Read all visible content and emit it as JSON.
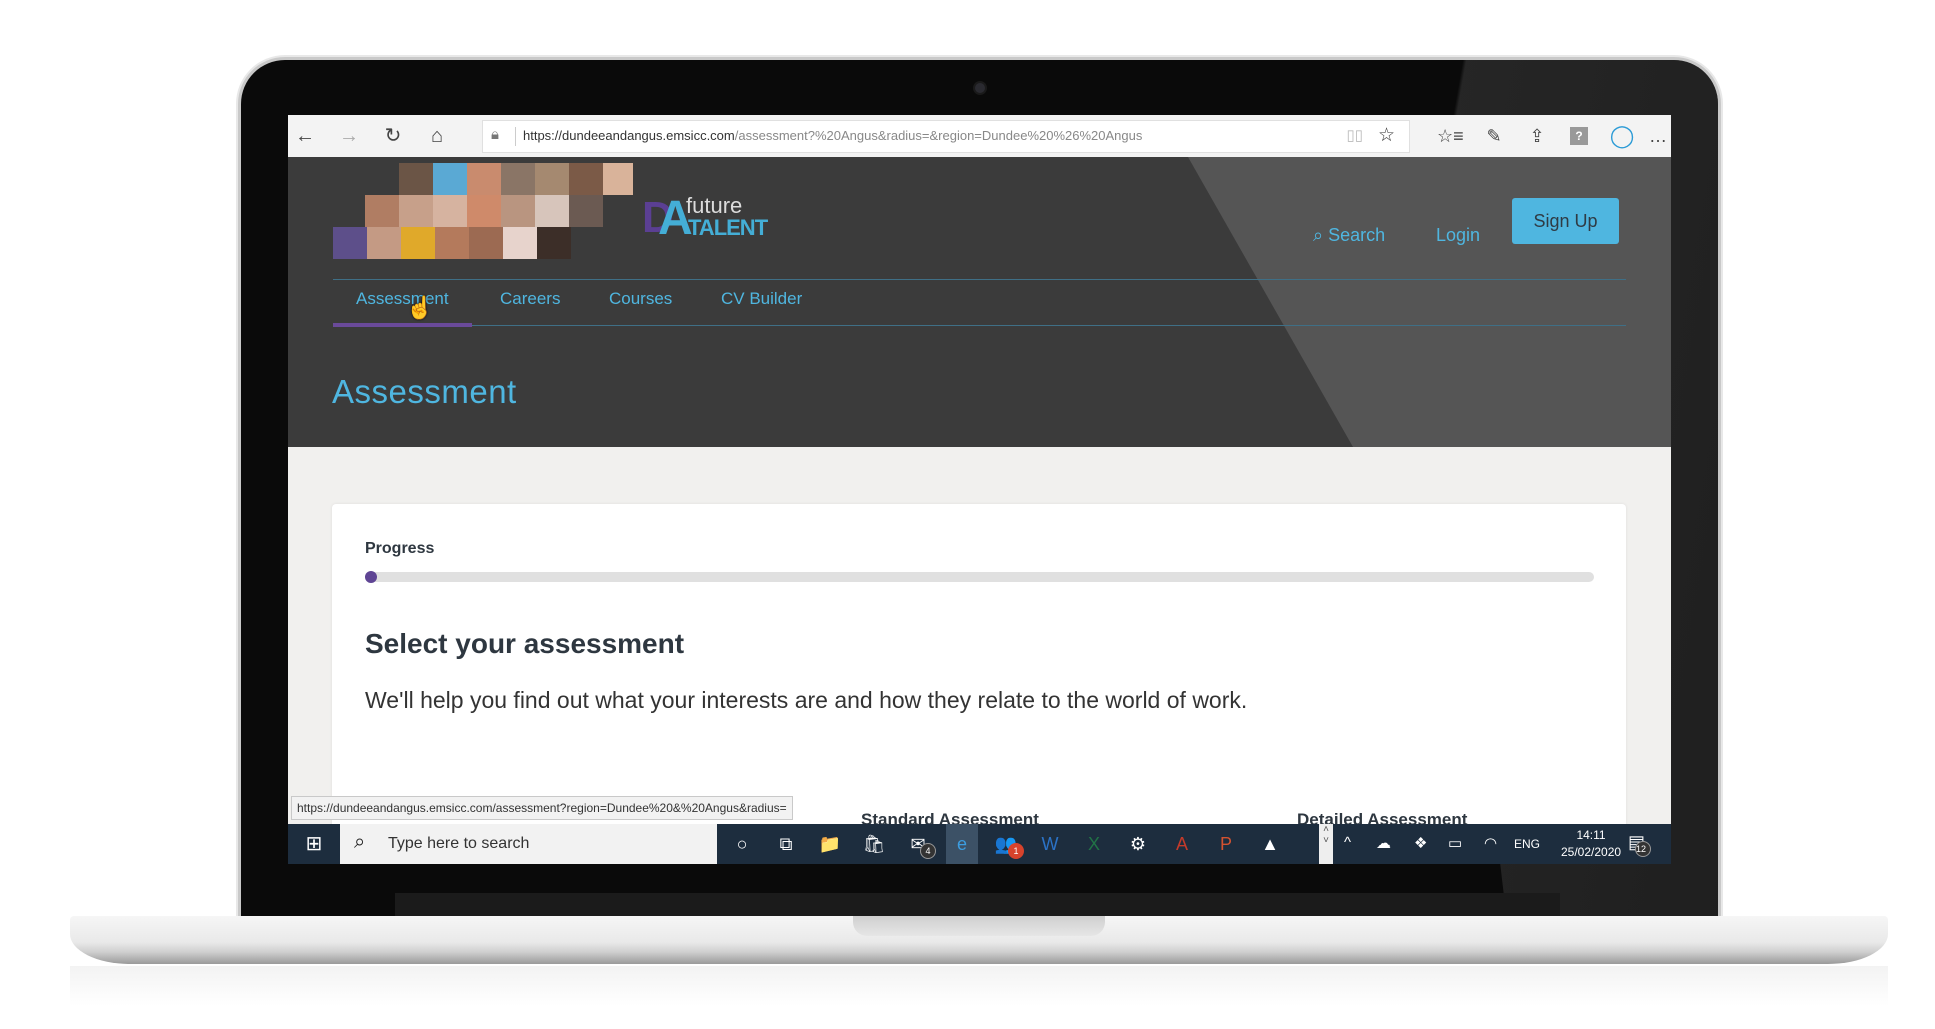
{
  "browser": {
    "url_host": "https://dundeeandangus.emsicc.com",
    "url_path": "/assessment?%20Angus&radius=&region=Dundee%20%26%20Angus",
    "icons": {
      "back": "←",
      "forward": "→",
      "refresh": "↻",
      "home": "⌂",
      "lock": "🔒",
      "reader": "📖",
      "favorite": "☆",
      "favorites_list": "☆≡",
      "notes": "✎",
      "share": "⇪",
      "help": "?",
      "extension": "◯",
      "more": "…"
    },
    "status_url": "https://dundeeandangus.emsicc.com/assessment?region=Dundee%20&%20Angus&radius="
  },
  "site": {
    "logo": {
      "d": "D",
      "a": "A",
      "future": "future",
      "talent": "TALENT"
    },
    "header_links": {
      "search": "Search",
      "login": "Login",
      "signup": "Sign Up"
    },
    "search_icon": "⌕",
    "nav": [
      {
        "label": "Assessment",
        "active": true
      },
      {
        "label": "Careers",
        "active": false
      },
      {
        "label": "Courses",
        "active": false
      },
      {
        "label": "CV Builder",
        "active": false
      }
    ],
    "page_title": "Assessment",
    "brand_colors": {
      "accent_blue": "#4fb6e0",
      "accent_purple": "#5f4594",
      "header_bg": "#3b3b3b"
    }
  },
  "content": {
    "progress_label": "Progress",
    "progress_fraction": 0.01,
    "select_title": "Select your assessment",
    "select_description": "We'll help you find out what your interests are and how they relate to the world of work.",
    "columns": [
      "Standard Assessment",
      "Detailed Assessment"
    ]
  },
  "taskbar": {
    "search_placeholder": "Type here to search",
    "apps": [
      {
        "name": "cortana",
        "glyph": "○"
      },
      {
        "name": "task-view",
        "glyph": "⧉"
      },
      {
        "name": "file-explorer",
        "glyph": "📁"
      },
      {
        "name": "store",
        "glyph": "🛍"
      },
      {
        "name": "mail",
        "glyph": "✉",
        "badge": "4"
      },
      {
        "name": "edge",
        "glyph": "e",
        "active": true
      },
      {
        "name": "teams",
        "glyph": "👥",
        "badge": "1"
      },
      {
        "name": "word",
        "glyph": "W"
      },
      {
        "name": "excel",
        "glyph": "X"
      },
      {
        "name": "settings",
        "glyph": "⚙"
      },
      {
        "name": "acrobat",
        "glyph": "A"
      },
      {
        "name": "powerpoint",
        "glyph": "P"
      },
      {
        "name": "photos",
        "glyph": "▲"
      }
    ],
    "tray": {
      "chevron": "^",
      "onedrive": "☁",
      "dropbox": "❖",
      "battery": "▭",
      "wifi": "◠",
      "language": "ENG"
    },
    "time": "14:11",
    "date": "25/02/2020",
    "notifications_count": "12"
  }
}
